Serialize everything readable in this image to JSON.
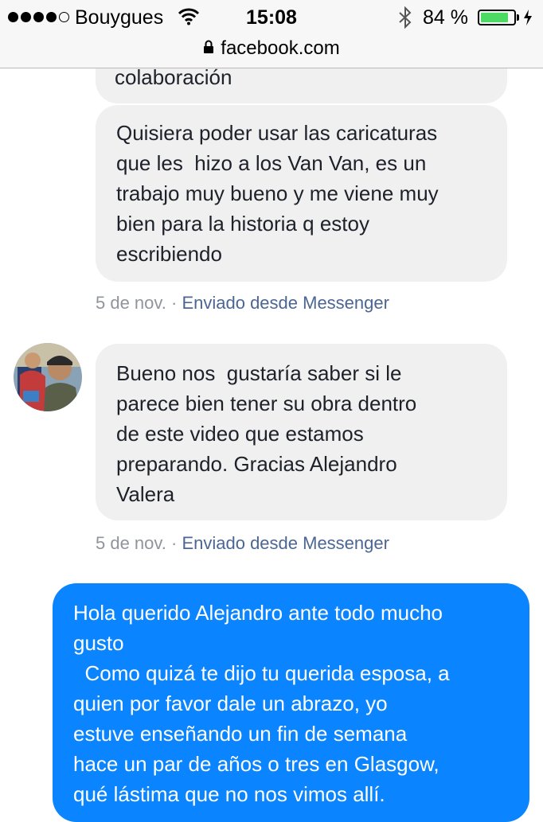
{
  "status_bar": {
    "carrier": "Bouygues",
    "time": "15:08",
    "battery_percent": "84 %",
    "battery_level": 0.84,
    "icons": [
      "signal-dots",
      "wifi-icon",
      "bluetooth-icon",
      "battery-icon",
      "charging-icon"
    ]
  },
  "url_bar": {
    "url": "facebook.com",
    "icon": "lock-icon"
  },
  "messages": [
    {
      "direction": "in",
      "text": "colaboración"
    },
    {
      "direction": "in",
      "text": "Quisiera poder usar las caricaturas\nque les  hizo a los Van Van, es un\ntrabajo muy bueno y me viene muy\nbien para la historia q estoy\nescribiendo",
      "meta_date": "5 de nov.",
      "meta_sep": " · ",
      "meta_via": "Enviado desde Messenger"
    },
    {
      "direction": "in",
      "text": "Bueno nos  gustaría saber si le\nparece bien tener su obra dentro\nde este video que estamos\npreparando. Gracias Alejandro\nValera",
      "meta_date": "5 de nov.",
      "meta_sep": " · ",
      "meta_via": "Enviado desde Messenger"
    },
    {
      "direction": "out",
      "text": "Hola querido Alejandro ante todo mucho\ngusto\n  Como quizá te dijo tu querida esposa, a\nquien por favor dale un abrazo, yo\nestuve enseñando un fin de semana\nhace un par de años o tres en Glasgow,\nqué lástima que no nos vimos allí."
    }
  ],
  "colors": {
    "incoming_bubble": "#f1f0f0",
    "outgoing_bubble": "#0a84ff",
    "meta_link": "#4b6693"
  }
}
